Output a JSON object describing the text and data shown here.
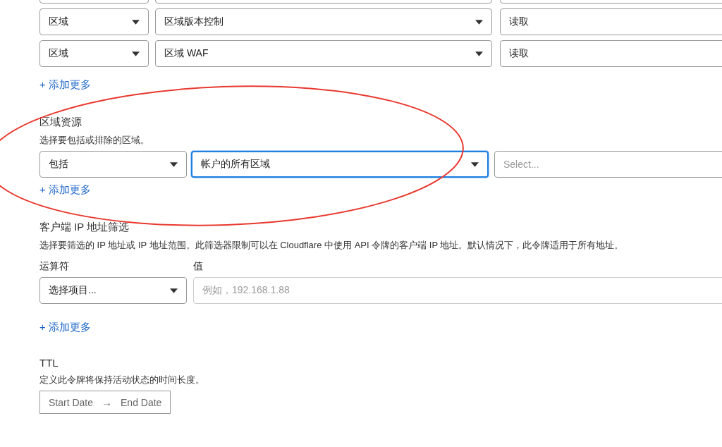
{
  "permission_rows": [
    {
      "kind": "clipped"
    },
    {
      "kind": "full",
      "scope": "区域",
      "permission": "区域版本控制",
      "access": "读取"
    },
    {
      "kind": "full",
      "scope": "区域",
      "permission": "区域 WAF",
      "access": "读取"
    }
  ],
  "permission_add_more": "+ 添加更多",
  "zone_resources": {
    "title": "区域资源",
    "description": "选择要包括或排除的区域。",
    "operator": "包括",
    "target": "帐户的所有区域",
    "target_focused": true,
    "extra_placeholder": "Select...",
    "add_more": "+ 添加更多"
  },
  "annotation": {
    "kind": "ellipse",
    "color": "#e8392f"
  },
  "ip_filter": {
    "title": "客户端 IP 地址筛选",
    "description": "选择要筛选的 IP 地址或 IP 地址范围。此筛选器限制可以在 Cloudflare 中使用 API 令牌的客户端 IP 地址。默认情况下，此令牌适用于所有地址。",
    "operator_label": "运算符",
    "value_label": "值",
    "operator_placeholder": "选择项目...",
    "value_placeholder": "例如，192.168.1.88",
    "add_more": "+ 添加更多"
  },
  "ttl": {
    "title": "TTL",
    "description": "定义此令牌将保持活动状态的时间长度。",
    "start": "Start Date",
    "arrow": "→",
    "end": "End Date"
  }
}
